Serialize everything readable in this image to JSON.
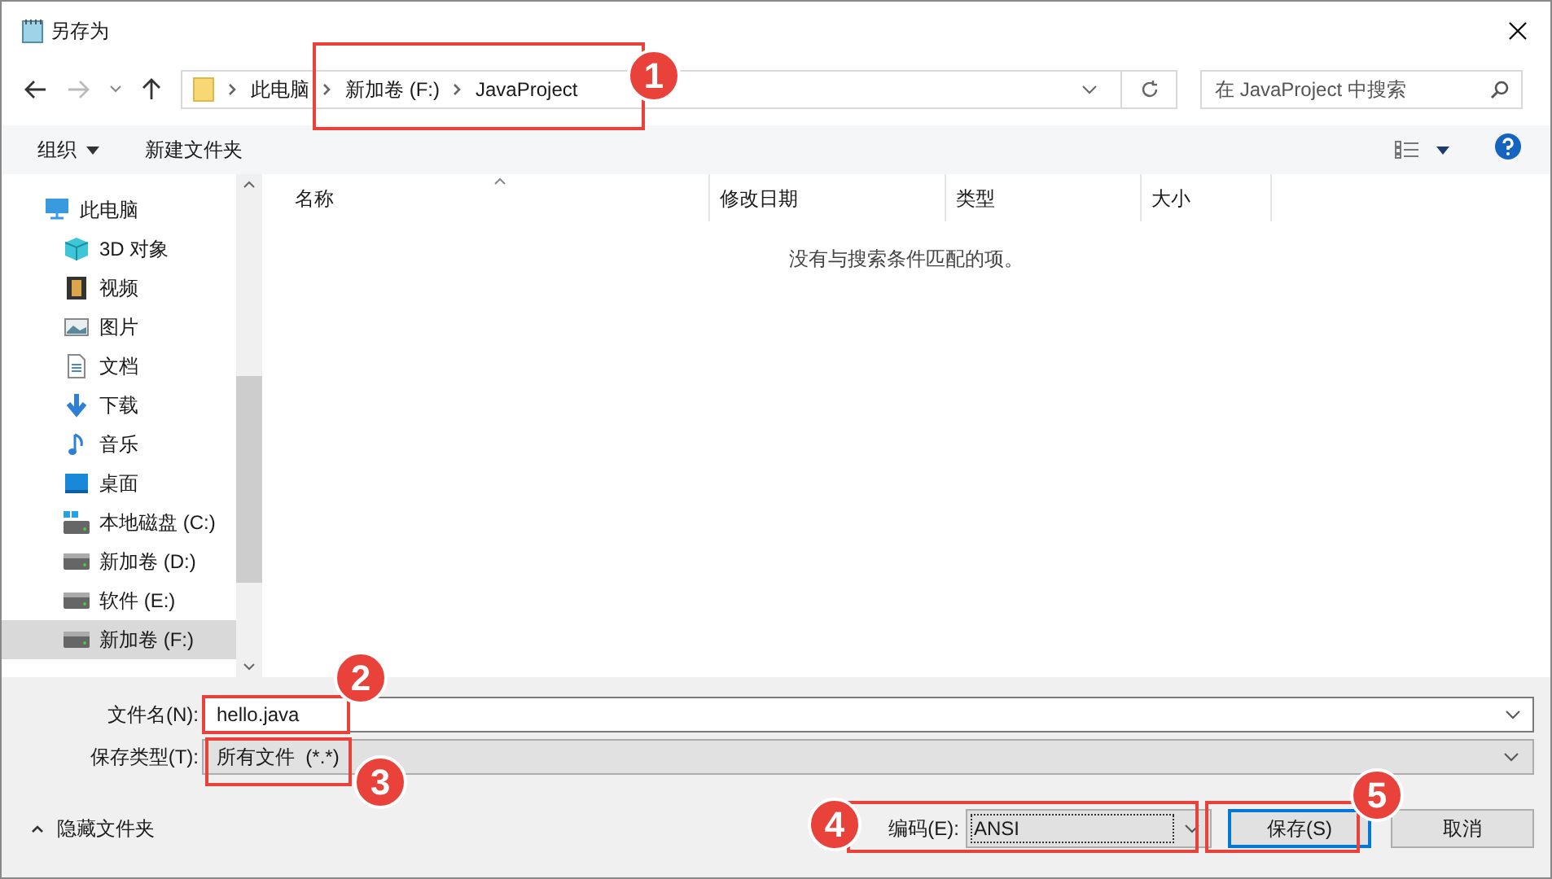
{
  "window": {
    "title": "另存为"
  },
  "nav": {
    "breadcrumb": [
      "此电脑",
      "新加卷 (F:)",
      "JavaProject"
    ],
    "search": {
      "placeholder": "在 JavaProject 中搜索"
    }
  },
  "toolbar": {
    "organize": "组织",
    "new_folder": "新建文件夹"
  },
  "sidebar": {
    "items": [
      {
        "label": "此电脑",
        "kind": "pc",
        "selected": false,
        "children": [
          {
            "label": "3D 对象",
            "kind": "cube",
            "selected": false
          },
          {
            "label": "视频",
            "kind": "video",
            "selected": false
          },
          {
            "label": "图片",
            "kind": "picture",
            "selected": false
          },
          {
            "label": "文档",
            "kind": "document",
            "selected": false
          },
          {
            "label": "下载",
            "kind": "download",
            "selected": false
          },
          {
            "label": "音乐",
            "kind": "music",
            "selected": false
          },
          {
            "label": "桌面",
            "kind": "desktop",
            "selected": false
          },
          {
            "label": "本地磁盘 (C:)",
            "kind": "system-drive",
            "selected": false
          },
          {
            "label": "新加卷 (D:)",
            "kind": "drive",
            "selected": false
          },
          {
            "label": "软件 (E:)",
            "kind": "drive",
            "selected": false
          },
          {
            "label": "新加卷 (F:)",
            "kind": "drive",
            "selected": true
          }
        ]
      }
    ]
  },
  "columns": [
    "名称",
    "修改日期",
    "类型",
    "大小"
  ],
  "empty_message": "没有与搜索条件匹配的项。",
  "form": {
    "filename_label": "文件名(N):",
    "filename": "hello.java",
    "type_label": "保存类型(T):",
    "type": "所有文件  (*.*)",
    "encoding_label": "编码(E):",
    "encoding": "ANSI"
  },
  "hide_folders": "隐藏文件夹",
  "buttons": [
    {
      "label": "保存(S)",
      "kind": "primary"
    },
    {
      "label": "取消",
      "kind": "normal"
    }
  ],
  "annotations": [
    {
      "number": "1"
    },
    {
      "number": "2"
    },
    {
      "number": "3"
    },
    {
      "number": "4"
    },
    {
      "number": "5"
    }
  ]
}
